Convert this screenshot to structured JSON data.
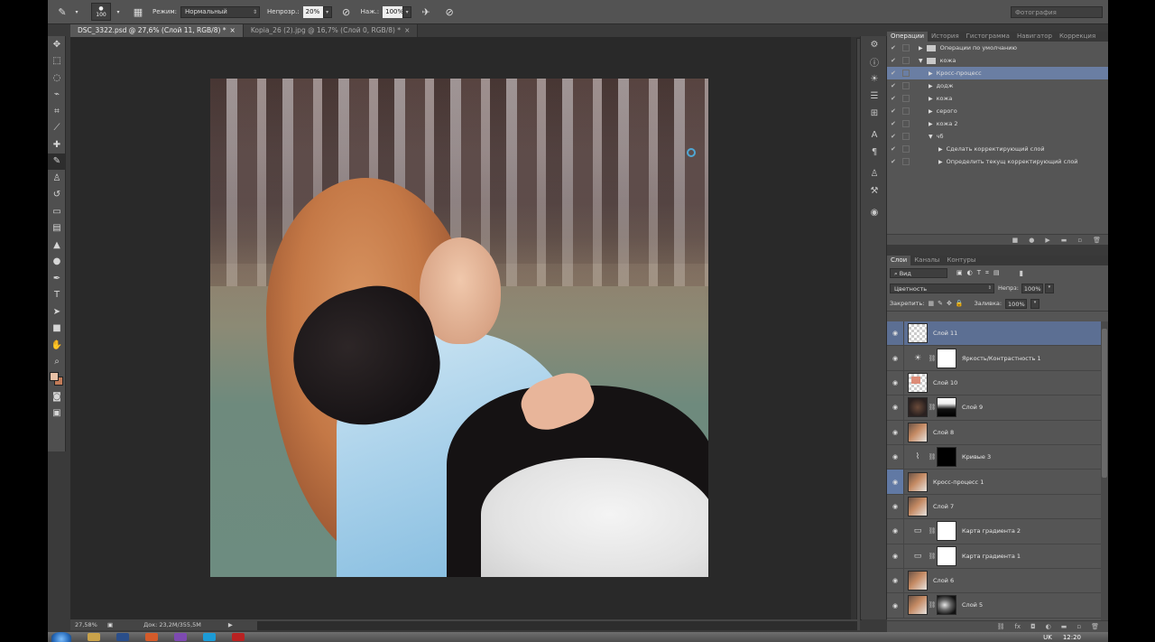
{
  "options_bar": {
    "brush_size": "100",
    "mode_label": "Режим:",
    "mode_value": "Нормальный",
    "opacity_label": "Непрозр.:",
    "opacity_value": "20%",
    "flow_label": "Наж.:",
    "flow_value": "100%",
    "workspace": "Фотография"
  },
  "tabs": [
    {
      "label": "DSC_3322.psd @ 27,6% (Слой 11, RGB/8) *",
      "close": "×"
    },
    {
      "label": "Kopia_26 (2).jpg @ 16,7% (Слой 0, RGB/8) *",
      "close": "×"
    }
  ],
  "status": {
    "zoom": "27,58%",
    "doc": "Док: 23,2M/355,5M"
  },
  "actions_panel": {
    "tabs": [
      "Операции",
      "История",
      "Гистограмма",
      "Навигатор",
      "Коррекция"
    ],
    "rows": [
      {
        "label": "Операции по умолчанию",
        "level": 0,
        "expanded": false,
        "folder": true
      },
      {
        "label": "кожа",
        "level": 0,
        "expanded": true,
        "folder": true
      },
      {
        "label": "Кросс-процесс",
        "level": 1,
        "expanded": false,
        "folder": false,
        "selected": true
      },
      {
        "label": "додж",
        "level": 1,
        "expanded": false,
        "folder": false
      },
      {
        "label": "кожа",
        "level": 1,
        "expanded": false,
        "folder": false
      },
      {
        "label": "серого",
        "level": 1,
        "expanded": false,
        "folder": false
      },
      {
        "label": "кожа 2",
        "level": 1,
        "expanded": false,
        "folder": false
      },
      {
        "label": "чб",
        "level": 1,
        "expanded": true,
        "folder": false
      },
      {
        "label": "Сделать корректирующий слой",
        "level": 2,
        "expanded": false,
        "folder": false
      },
      {
        "label": "Определить текущ корректирующий слой",
        "level": 2,
        "expanded": false,
        "folder": false
      }
    ]
  },
  "layers_panel": {
    "tabs": [
      "Слои",
      "Каналы",
      "Контуры"
    ],
    "kind_filter": "Вид",
    "blend_mode": "Цветность",
    "opacity_label": "Непрз:",
    "opacity_value": "100%",
    "lock_label": "Закрепить:",
    "fill_label": "Заливка:",
    "fill_value": "100%",
    "layers": [
      {
        "name": "Слой 11",
        "thumb": "trans",
        "mask": null,
        "adj": null,
        "selected": true
      },
      {
        "name": "Яркость/Контрастность 1",
        "thumb": null,
        "mask": "white",
        "adj": "brightness-icon",
        "selected": false
      },
      {
        "name": "Слой 10",
        "thumb": "trans-red",
        "mask": null,
        "adj": null,
        "selected": false
      },
      {
        "name": "Слой 9",
        "thumb": "dark",
        "mask": "bw",
        "adj": null,
        "selected": false
      },
      {
        "name": "Слой 8",
        "thumb": "photo-t",
        "mask": null,
        "adj": null,
        "selected": false
      },
      {
        "name": "Кривые 3",
        "thumb": null,
        "mask": "black",
        "adj": "curves-icon",
        "selected": false
      },
      {
        "name": "Кросс-процесс 1",
        "thumb": "photo-t",
        "mask": null,
        "adj": null,
        "selected": false,
        "highlight_eye": true
      },
      {
        "name": "Слой 7",
        "thumb": "photo-t",
        "mask": null,
        "adj": null,
        "selected": false
      },
      {
        "name": "Карта градиента 2",
        "thumb": null,
        "mask": "white",
        "adj": "gradient-map-icon",
        "selected": false
      },
      {
        "name": "Карта градиента 1",
        "thumb": null,
        "mask": "white",
        "adj": "gradient-map-icon",
        "selected": false
      },
      {
        "name": "Слой 6",
        "thumb": "photo-t",
        "mask": null,
        "adj": null,
        "selected": false
      },
      {
        "name": "Слой 5",
        "thumb": "photo-t",
        "mask": "bwdark",
        "adj": null,
        "selected": false
      }
    ]
  },
  "taskbar": {
    "lang": "UK",
    "clock": "12:20"
  }
}
